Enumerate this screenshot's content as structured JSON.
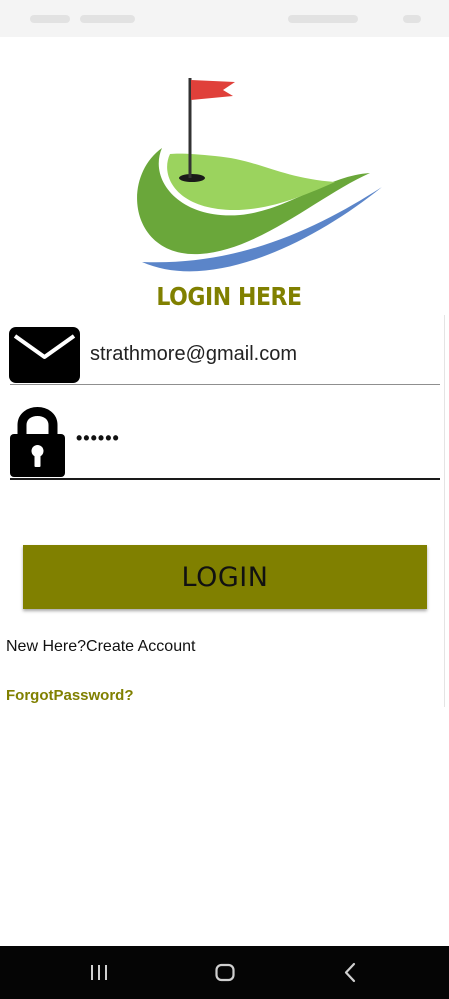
{
  "app": {
    "title": "LOGIN HERE"
  },
  "form": {
    "email_value": "strathmore@gmail.com",
    "password_value": "••••••",
    "login_button_label": "LOGIN",
    "create_account_label": "New Here?Create Account",
    "forgot_password_label": "ForgotPassword?"
  },
  "icons": {
    "email": "envelope-icon",
    "password": "lock-icon",
    "logo": "golf-green-flag-logo"
  },
  "colors": {
    "accent": "#808000",
    "logo_green": "#6cb33f",
    "logo_blue": "#5b85c9",
    "flag_red": "#e0403a"
  },
  "navigation": {
    "items": [
      "recent-apps",
      "home",
      "back"
    ]
  }
}
